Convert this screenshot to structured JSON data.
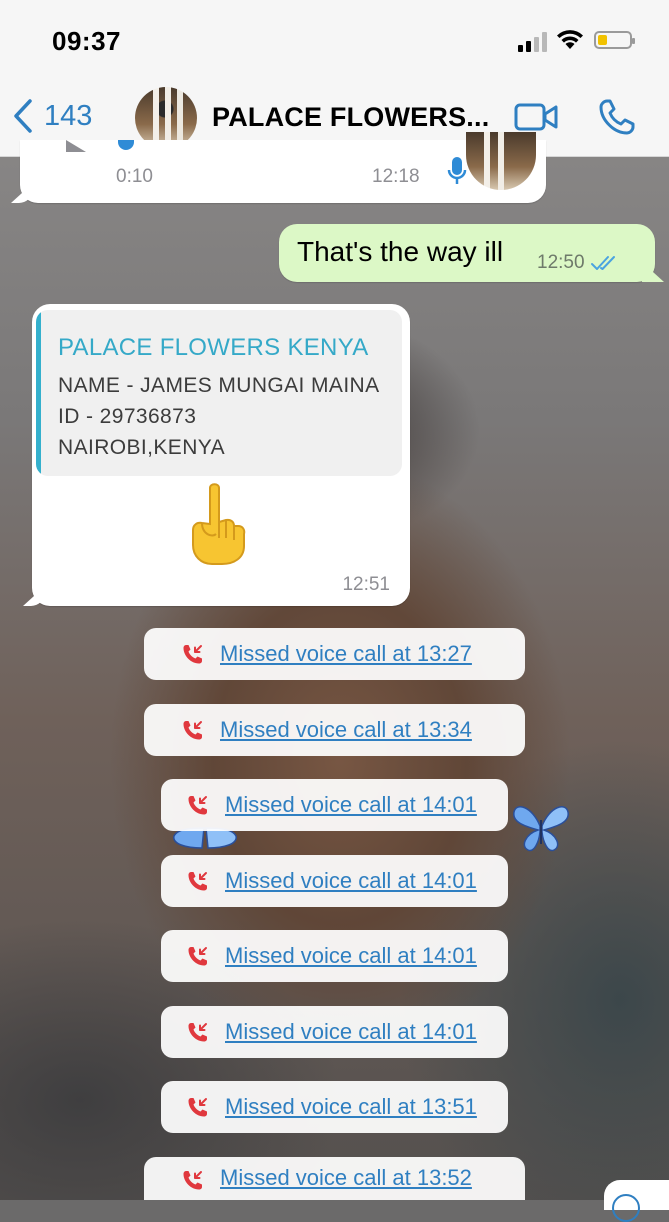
{
  "status_bar": {
    "time": "09:37"
  },
  "nav": {
    "back_count": "143",
    "title": "PALACE FLOWERS...",
    "icons": [
      "chevron-left-icon",
      "video-call-icon",
      "phone-icon"
    ]
  },
  "messages": {
    "voice_note": {
      "duration": "0:10",
      "time": "12:18"
    },
    "outgoing": {
      "text": "That's the way ill",
      "time": "12:50",
      "status": "read"
    },
    "contact_card": {
      "title": "PALACE FLOWERS KENYA",
      "lines": [
        "NAME - JAMES MUNGAI MAINA",
        "ID - 29736873",
        "NAIROBI,KENYA"
      ],
      "emoji": "☝️",
      "time": "12:51"
    }
  },
  "missed_calls": [
    "Missed voice call at 13:27",
    "Missed voice call at 13:34",
    "Missed voice call at 14:01",
    "Missed voice call at 14:01",
    "Missed voice call at 14:01",
    "Missed voice call at 14:01",
    "Missed voice call at 13:51",
    "Missed voice call at 13:52"
  ],
  "colors": {
    "accent": "#2f7fc1",
    "outgoing_bubble": "#dcf8c6",
    "quote_bar": "#34b0cd",
    "missed_call_red": "#e0383e"
  }
}
